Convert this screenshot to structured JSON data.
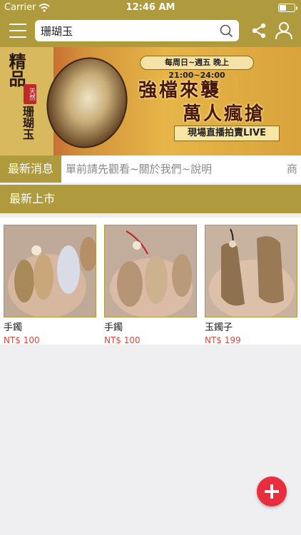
{
  "status_bar": {
    "carrier": "Carrier",
    "time": "12:46 AM",
    "battery_level": 0.4
  },
  "nav": {
    "search_value": "珊瑚玉",
    "menu_icon": "menu-icon",
    "search_icon": "search-icon",
    "share_icon": "share-icon",
    "user_icon": "user-icon"
  },
  "banner": {
    "calligraphy_top": "精品",
    "stamp": "天然",
    "calligraphy_bottom": "珊瑚玉",
    "schedule": "每周日~週五 晚上21:00~24:00",
    "slogan_line1": "強檔來襲",
    "slogan_line2": "萬人瘋搶",
    "live_label": "現場直播拍賣LIVE"
  },
  "news": {
    "label": "最新消息",
    "ticker": "單前請先觀看~關於我們~說明",
    "ticker_more": "商"
  },
  "new_arrivals": {
    "title": "最新上市",
    "products": [
      {
        "name": "手鐲",
        "price": "NT$ 100"
      },
      {
        "name": "手鐲",
        "price": "NT$ 100"
      },
      {
        "name": "玉鐲子",
        "price": "NT$ 199"
      }
    ]
  },
  "colors": {
    "accent": "#b09a3e",
    "price": "#d94a3c",
    "fab": "#ea2d3d"
  },
  "fab": {
    "icon": "plus-icon"
  }
}
